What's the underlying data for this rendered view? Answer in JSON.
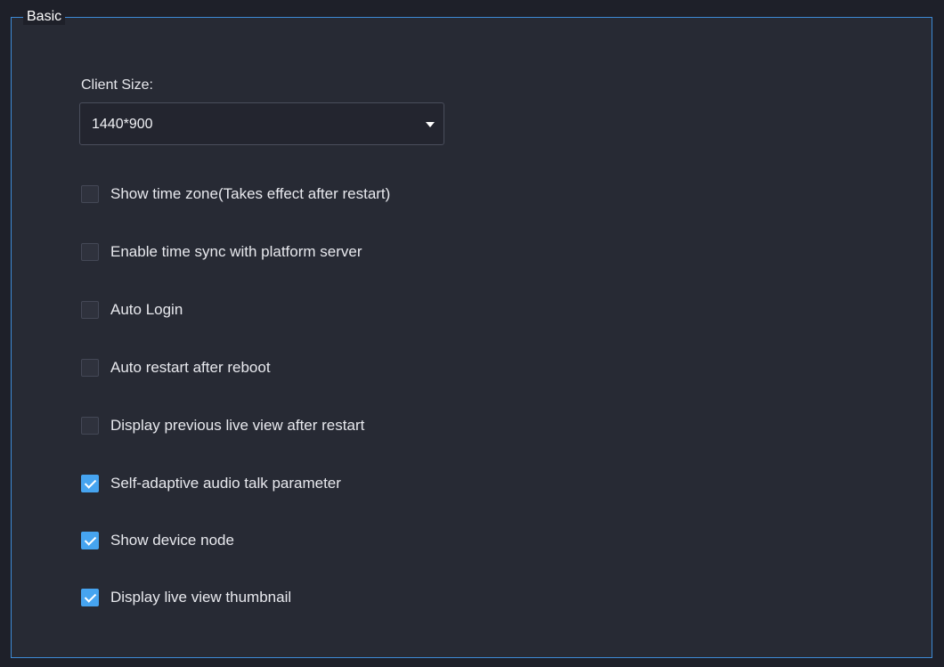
{
  "section": {
    "title": "Basic"
  },
  "client_size": {
    "label": "Client Size:",
    "value": "1440*900"
  },
  "options": [
    {
      "label": "Show time zone(Takes effect after restart)",
      "checked": false
    },
    {
      "label": "Enable time sync with platform server",
      "checked": false
    },
    {
      "label": "Auto Login",
      "checked": false
    },
    {
      "label": "Auto restart after reboot",
      "checked": false
    },
    {
      "label": "Display previous live view after restart",
      "checked": false
    },
    {
      "label": "Self-adaptive audio talk parameter",
      "checked": true
    },
    {
      "label": "Show device node",
      "checked": true
    },
    {
      "label": "Display live view thumbnail",
      "checked": true
    }
  ],
  "colors": {
    "accent": "#46a4f0",
    "border": "#3d8ad6",
    "panel": "#272a34"
  }
}
